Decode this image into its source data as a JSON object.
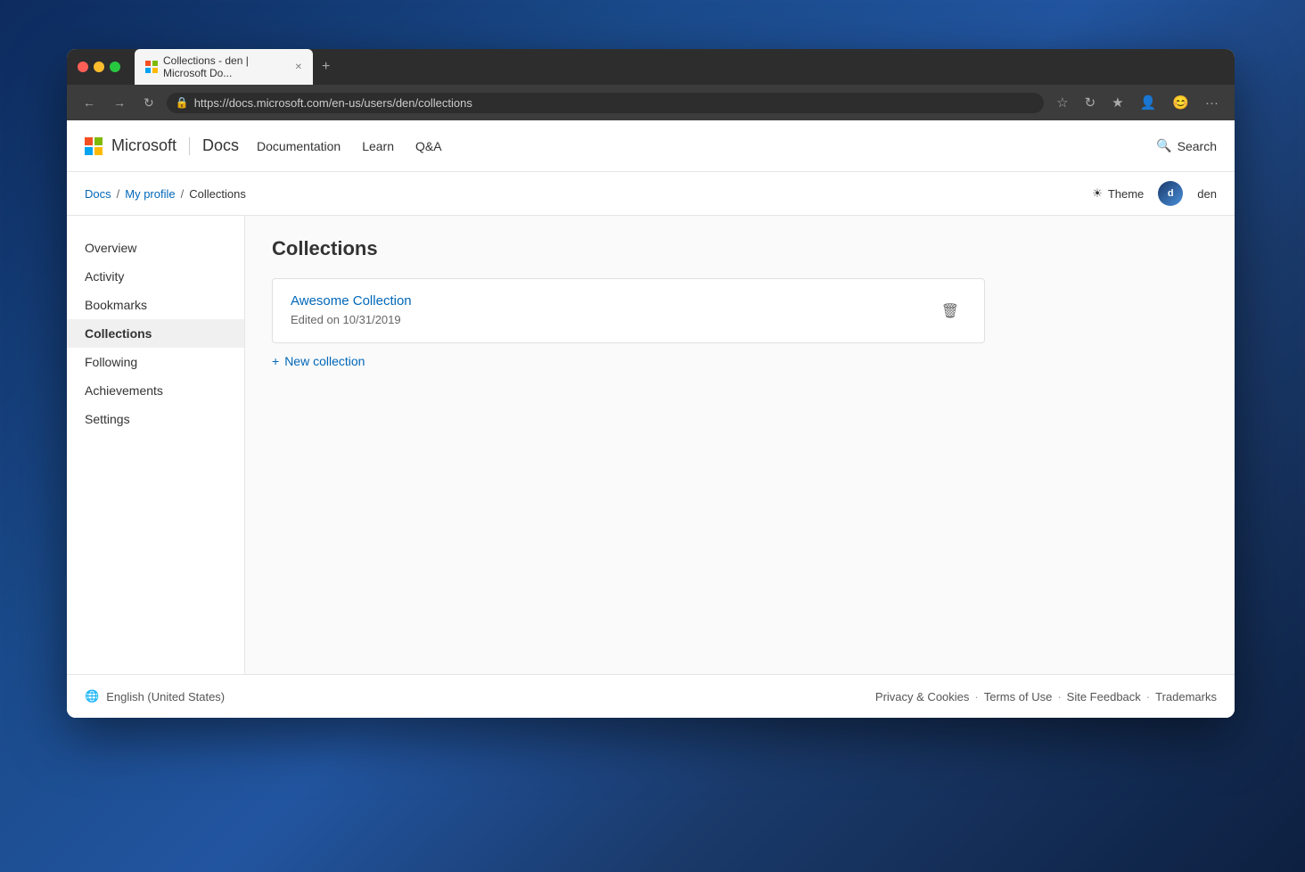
{
  "desktop": {
    "background": "#1a3a6b"
  },
  "browser": {
    "tab_title": "Collections - den | Microsoft Do...",
    "tab_favicon": "M",
    "url_display": "https://docs.microsoft.com/en-us/users/den/collections",
    "url_base": "https://docs.microsoft.com",
    "url_path": "/en-us/users/den/collections"
  },
  "header": {
    "brand": "Microsoft",
    "docs": "Docs",
    "nav_items": [
      {
        "label": "Documentation",
        "href": "#"
      },
      {
        "label": "Learn",
        "href": "#"
      },
      {
        "label": "Q&A",
        "href": "#"
      }
    ],
    "search_label": "Search",
    "theme_label": "Theme",
    "user_name": "den",
    "user_initials": "d"
  },
  "breadcrumb": {
    "items": [
      {
        "label": "Docs",
        "href": "#"
      },
      {
        "label": "My profile",
        "href": "#"
      },
      {
        "label": "Collections",
        "href": null
      }
    ]
  },
  "sidebar": {
    "items": [
      {
        "label": "Overview",
        "active": false
      },
      {
        "label": "Activity",
        "active": false
      },
      {
        "label": "Bookmarks",
        "active": false
      },
      {
        "label": "Collections",
        "active": true
      },
      {
        "label": "Following",
        "active": false
      },
      {
        "label": "Achievements",
        "active": false
      },
      {
        "label": "Settings",
        "active": false
      }
    ]
  },
  "main": {
    "title": "Collections",
    "collection": {
      "name": "Awesome Collection",
      "edited": "Edited on 10/31/2019",
      "delete_icon": "🗑"
    },
    "new_collection_label": "New collection",
    "plus_icon": "+"
  },
  "footer": {
    "locale_icon": "🌐",
    "locale_label": "English (United States)",
    "links": [
      {
        "label": "Privacy & Cookies"
      },
      {
        "label": "Terms of Use"
      },
      {
        "label": "Site Feedback"
      },
      {
        "label": "Trademarks"
      }
    ]
  }
}
